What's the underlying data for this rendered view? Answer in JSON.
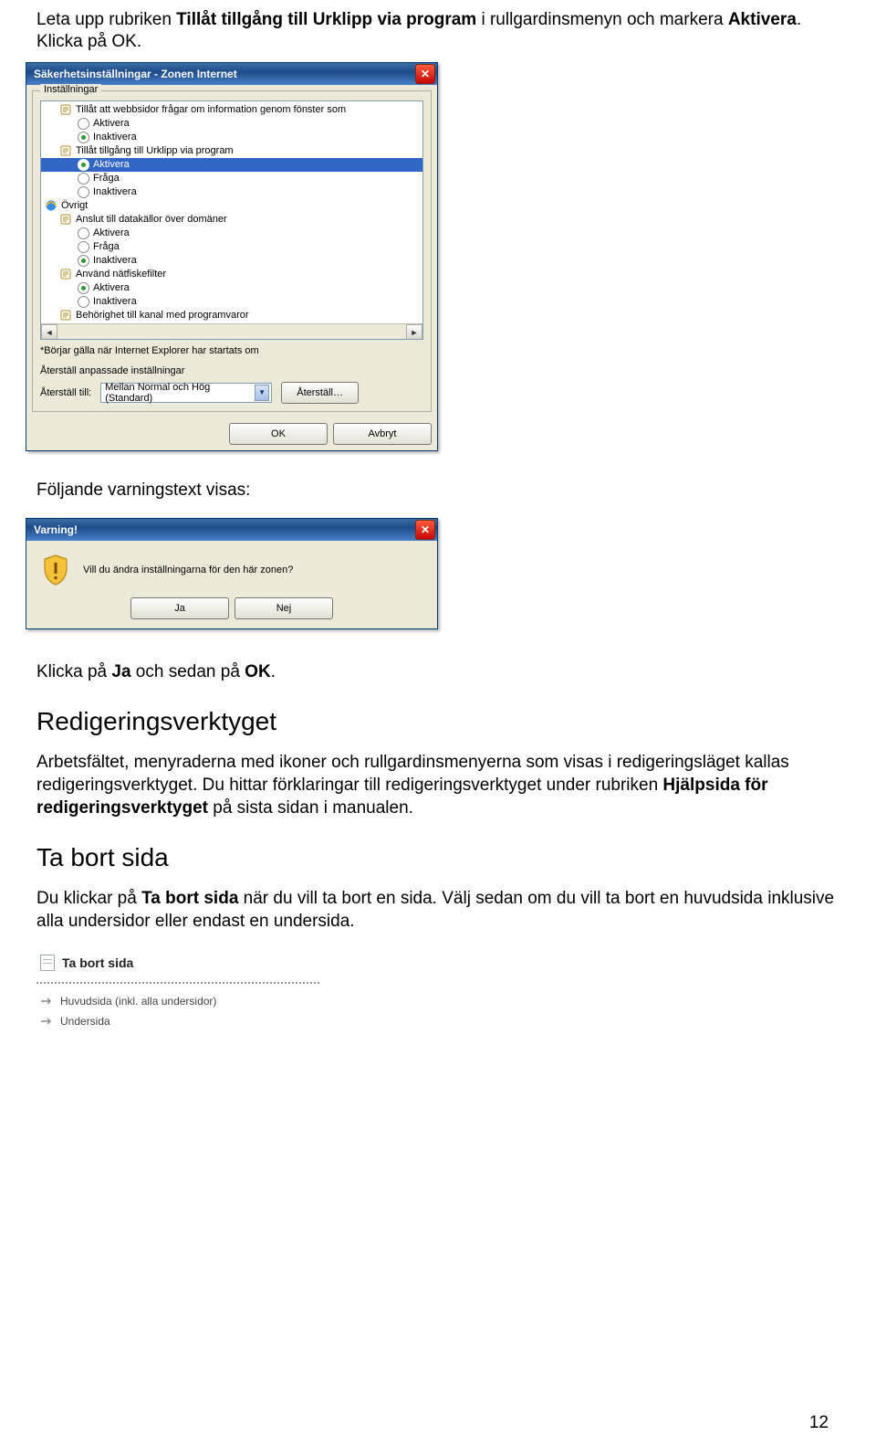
{
  "doc": {
    "intro_pre": "Leta upp rubriken ",
    "intro_bold1": "Tillåt tillgång till Urklipp via program",
    "intro_mid": " i rullgardinsmenyn och markera ",
    "intro_bold2": "Aktivera",
    "intro_post": ". Klicka på OK.",
    "warn_intro": "Följande varningstext visas:",
    "after_warn_pre": "Klicka på ",
    "after_warn_b1": "Ja",
    "after_warn_mid": " och sedan på ",
    "after_warn_b2": "OK",
    "after_warn_post": ".",
    "h_redig": "Redigeringsverktyget",
    "redig_para_pre": "Arbetsfältet, menyraderna med ikoner och rullgardinsmenyerna som visas i redigeringsläget kallas redigeringsverktyget. Du hittar förklaringar till redigeringsverktyget under rubriken ",
    "redig_para_bold": "Hjälpsida för redigeringsverktyget",
    "redig_para_post": " på sista sidan i manualen.",
    "h_tabort": "Ta bort sida",
    "tabort_para_pre": "Du klickar på ",
    "tabort_para_bold": "Ta bort sida",
    "tabort_para_post": " när du vill ta bort en sida. Välj sedan om du vill ta bort en huvudsida inklusive alla undersidor eller endast en undersida.",
    "page_number": "12"
  },
  "sec_dialog": {
    "title": "Säkerhetsinställningar - Zonen Internet",
    "group": "Inställningar",
    "rows": [
      {
        "icon": "scroll",
        "indent": 1,
        "label": "Tillåt att webbsidor frågar om information genom fönster som"
      },
      {
        "icon": "radio",
        "checked": false,
        "indent": 2,
        "label": "Aktivera"
      },
      {
        "icon": "radio",
        "checked": true,
        "indent": 2,
        "label": "Inaktivera"
      },
      {
        "icon": "scroll",
        "indent": 1,
        "label": "Tillåt tillgång till Urklipp via program"
      },
      {
        "icon": "radio",
        "checked": true,
        "indent": 2,
        "label": "Aktivera",
        "selected": true
      },
      {
        "icon": "radio",
        "checked": false,
        "indent": 2,
        "label": "Fråga"
      },
      {
        "icon": "radio",
        "checked": false,
        "indent": 2,
        "label": "Inaktivera"
      },
      {
        "icon": "ie",
        "indent": 0,
        "label": "Övrigt"
      },
      {
        "icon": "scroll",
        "indent": 1,
        "label": "Anslut till datakällor över domäner"
      },
      {
        "icon": "radio",
        "checked": false,
        "indent": 2,
        "label": "Aktivera"
      },
      {
        "icon": "radio",
        "checked": false,
        "indent": 2,
        "label": "Fråga"
      },
      {
        "icon": "radio",
        "checked": true,
        "indent": 2,
        "label": "Inaktivera"
      },
      {
        "icon": "scroll",
        "indent": 1,
        "label": "Använd nätfiskefilter"
      },
      {
        "icon": "radio",
        "checked": true,
        "indent": 2,
        "label": "Aktivera"
      },
      {
        "icon": "radio",
        "checked": false,
        "indent": 2,
        "label": "Inaktivera"
      },
      {
        "icon": "scroll",
        "indent": 1,
        "label": "Behörighet till kanal med programvaror"
      }
    ],
    "note": "*Börjar gälla när Internet Explorer har startats om",
    "reset_label": "Återställ anpassade inställningar",
    "reset_to_label": "Återställ till:",
    "combo_value": "Mellan Normal och Hög (Standard)",
    "reset_btn": "Återställ…",
    "ok": "OK",
    "cancel": "Avbryt"
  },
  "warn_dialog": {
    "title": "Varning!",
    "text": "Vill du ändra inställningarna för den här zonen?",
    "yes": "Ja",
    "no": "Nej"
  },
  "menu": {
    "title": "Ta bort sida",
    "items": [
      "Huvudsida (inkl. alla undersidor)",
      "Undersida"
    ]
  }
}
